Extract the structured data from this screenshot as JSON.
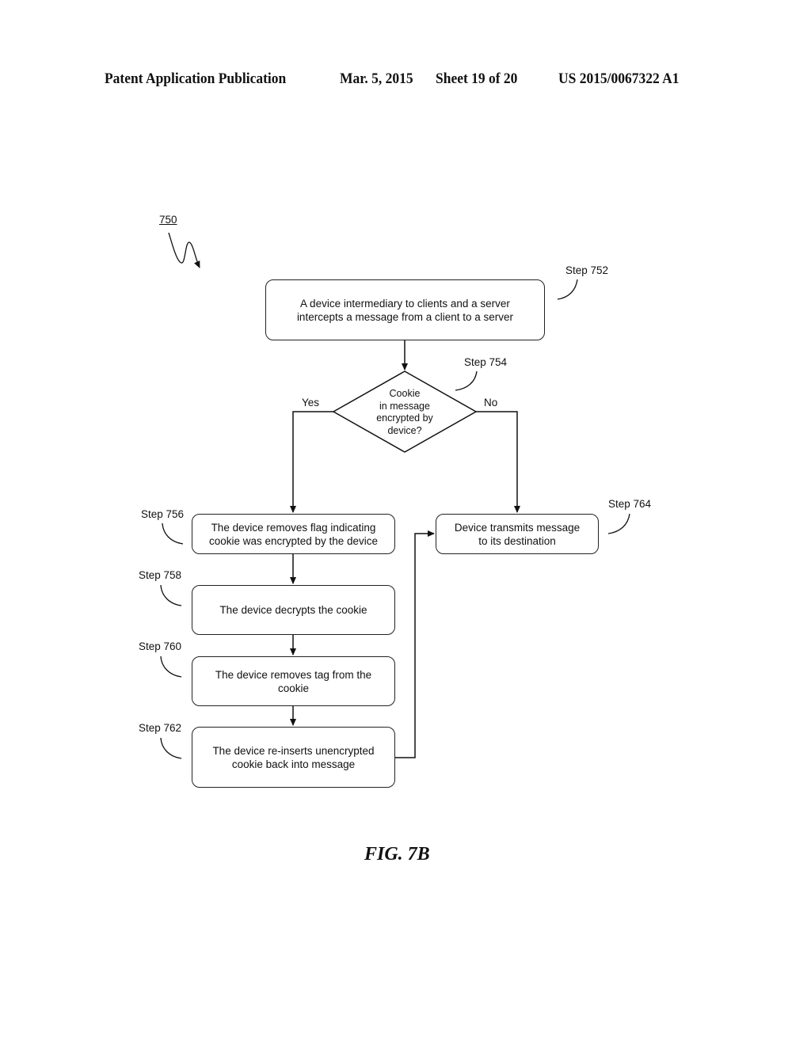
{
  "header": {
    "publication": "Patent Application Publication",
    "date": "Mar. 5, 2015",
    "sheet": "Sheet 19 of 20",
    "number": "US 2015/0067322 A1"
  },
  "figure": {
    "reference_numeral": "750",
    "caption": "FIG. 7B"
  },
  "flowchart": {
    "nodes": [
      {
        "id": "752",
        "step_label": "Step 752",
        "text_lines": [
          "A device intermediary to clients and a server",
          "intercepts a message from a client to a server"
        ]
      },
      {
        "id": "754",
        "step_label": "Step 754",
        "type": "decision",
        "text_lines": [
          "Cookie",
          "in message",
          "encrypted by",
          "device?"
        ]
      },
      {
        "id": "756",
        "step_label": "Step 756",
        "text_lines": [
          "The device removes flag indicating",
          "cookie was encrypted by the device"
        ]
      },
      {
        "id": "758",
        "step_label": "Step 758",
        "text_lines": [
          "The device decrypts the cookie"
        ]
      },
      {
        "id": "760",
        "step_label": "Step 760",
        "text_lines": [
          "The device removes tag from the",
          "cookie"
        ]
      },
      {
        "id": "762",
        "step_label": "Step 762",
        "text_lines": [
          "The device re-inserts unencrypted",
          "cookie back into message"
        ]
      },
      {
        "id": "764",
        "step_label": "Step 764",
        "text_lines": [
          "Device transmits message",
          "to its destination"
        ]
      }
    ],
    "branches": {
      "yes": "Yes",
      "no": "No"
    },
    "edges": [
      {
        "from": "752",
        "to": "754"
      },
      {
        "from": "754",
        "to": "756",
        "label": "Yes"
      },
      {
        "from": "754",
        "to": "764",
        "label": "No"
      },
      {
        "from": "756",
        "to": "758"
      },
      {
        "from": "758",
        "to": "760"
      },
      {
        "from": "760",
        "to": "762"
      },
      {
        "from": "762",
        "to": "764"
      }
    ]
  }
}
